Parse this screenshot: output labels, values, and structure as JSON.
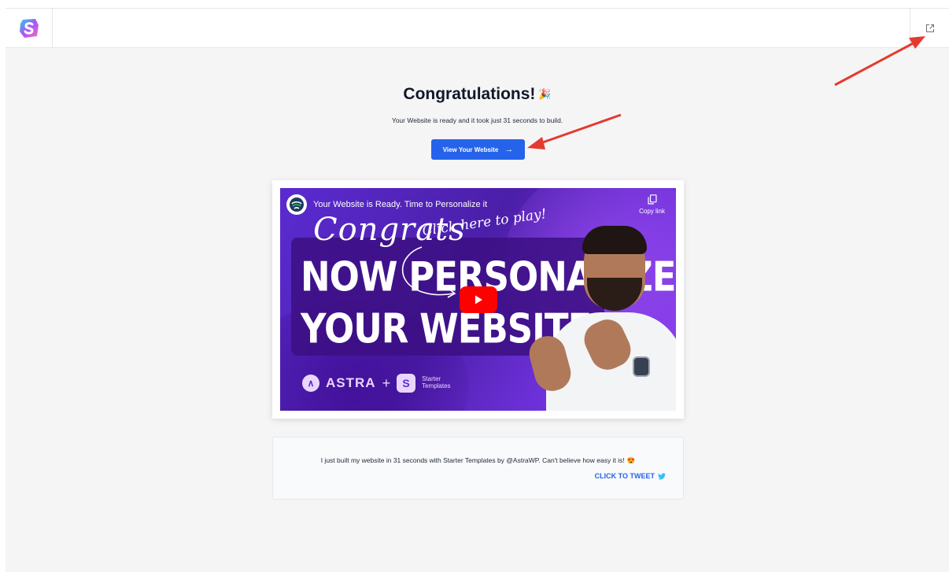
{
  "header": {
    "logo_icon": "starter-templates-logo",
    "exit_icon": "external-link-icon"
  },
  "main": {
    "title": "Congratulations!",
    "title_emoji": "🎉",
    "subtitle": "Your Website is ready and it took just 31 seconds to build.",
    "cta_label": "View Your Website",
    "cta_arrow": "→"
  },
  "video": {
    "title": "Your Website is Ready. Time to Personalize it",
    "copy_link": "Copy link",
    "thumb_congrats": "Congrats",
    "thumb_click": "Click here to play!",
    "thumb_line1": "NOW PERSONALIZE",
    "thumb_line2": "YOUR WEBSITE",
    "brand_astra": "ASTRA",
    "brand_plus": "+",
    "brand_st_line1": "Starter",
    "brand_st_line2": "Templates"
  },
  "tweet": {
    "text": "I just built my website in 31 seconds with Starter Templates by @AstraWP. Can't believe how easy it is!",
    "emoji": "😍",
    "cta": "CLICK TO TWEET"
  },
  "colors": {
    "accent": "#2563eb",
    "background": "#f5f5f6",
    "video_purple": "#5b2bd1",
    "annotation_red": "#e53a2e"
  }
}
